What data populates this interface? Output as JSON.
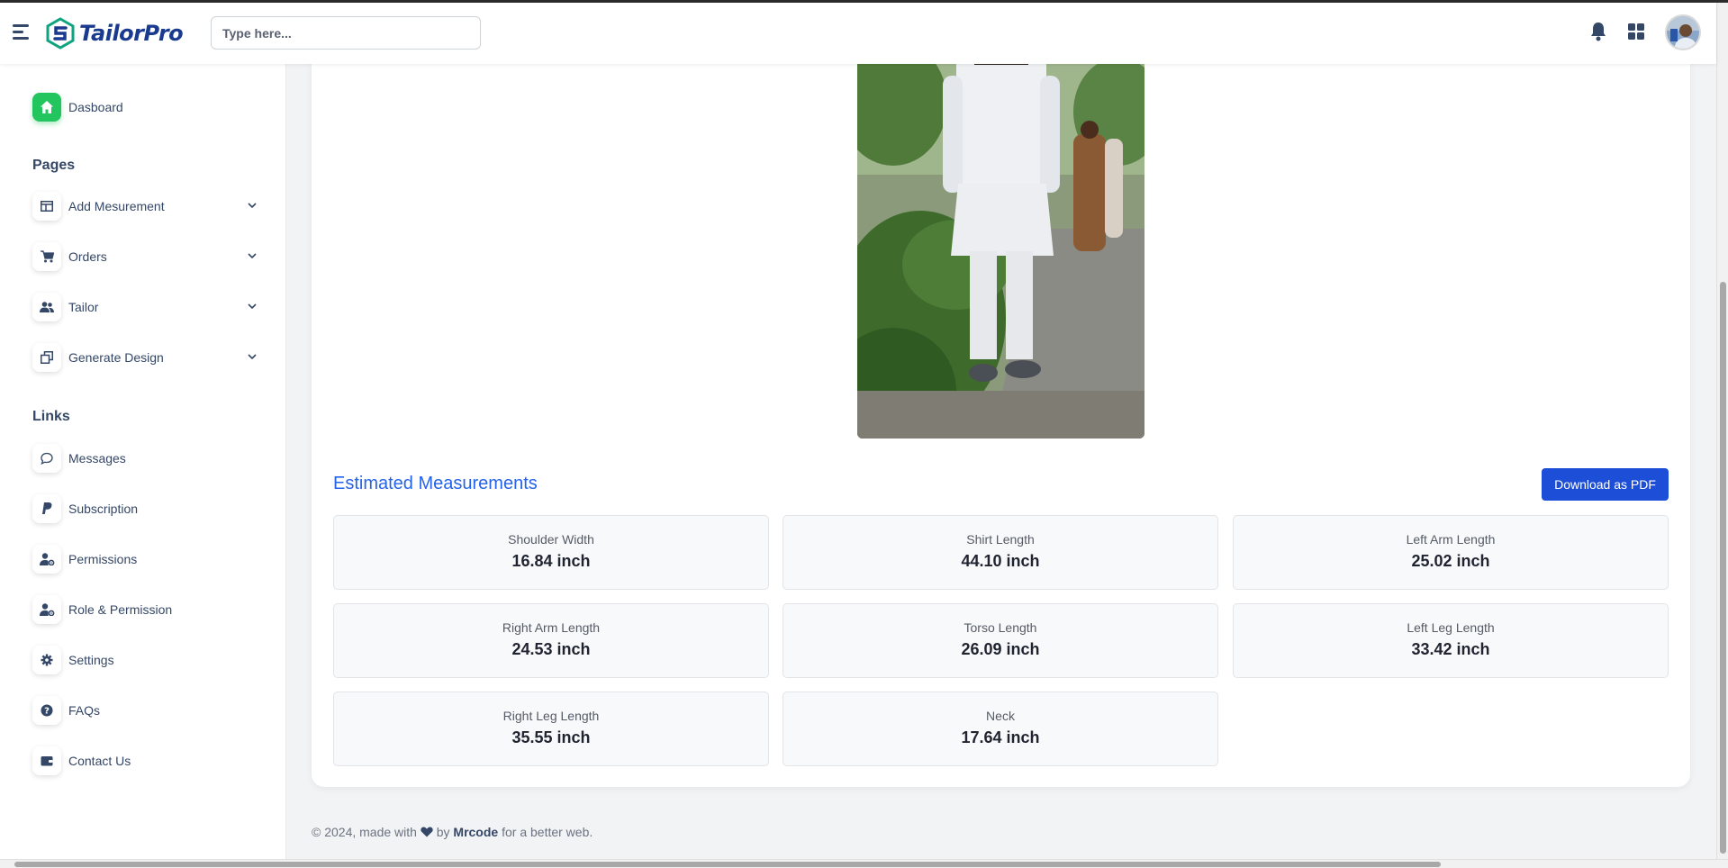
{
  "navbar": {
    "brand": "TailorPro",
    "search_placeholder": "Type here..."
  },
  "sidebar": {
    "dashboard_label": "Dasboard",
    "pages_title": "Pages",
    "pages": [
      {
        "label": "Add Mesurement",
        "icon": "table-icon"
      },
      {
        "label": "Orders",
        "icon": "cart-icon"
      },
      {
        "label": "Tailor",
        "icon": "users-icon"
      },
      {
        "label": "Generate Design",
        "icon": "layers-icon"
      }
    ],
    "links_title": "Links",
    "links": [
      {
        "label": "Messages",
        "icon": "chat-icon"
      },
      {
        "label": "Subscription",
        "icon": "paypal-icon"
      },
      {
        "label": "Permissions",
        "icon": "user-gear-icon"
      },
      {
        "label": "Role & Permission",
        "icon": "user-gear-icon"
      },
      {
        "label": "Settings",
        "icon": "gear-icon"
      },
      {
        "label": "FAQs",
        "icon": "question-icon"
      },
      {
        "label": "Contact Us",
        "icon": "wallet-icon"
      }
    ]
  },
  "main": {
    "section_title": "Estimated Measurements",
    "download_label": "Download as PDF",
    "measurements": [
      {
        "label": "Shoulder Width",
        "value": "16.84 inch"
      },
      {
        "label": "Shirt Length",
        "value": "44.10 inch"
      },
      {
        "label": "Left Arm Length",
        "value": "25.02 inch"
      },
      {
        "label": "Right Arm Length",
        "value": "24.53 inch"
      },
      {
        "label": "Torso Length",
        "value": "26.09 inch"
      },
      {
        "label": "Left Leg Length",
        "value": "33.42 inch"
      },
      {
        "label": "Right Leg Length",
        "value": "35.55 inch"
      },
      {
        "label": "Neck",
        "value": "17.64 inch"
      }
    ]
  },
  "footer": {
    "prefix": "© 2024, made with",
    "by": "by",
    "author": "Mrcode",
    "suffix": "for a better web."
  },
  "colors": {
    "accent": "#2563eb",
    "button": "#1d4ed8",
    "active": "#22c55e"
  }
}
